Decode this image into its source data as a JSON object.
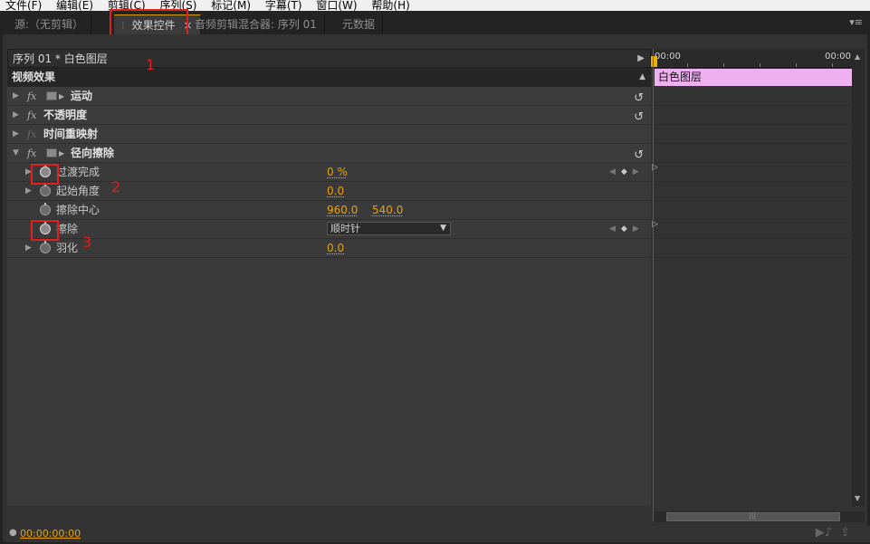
{
  "menu": [
    "文件(F)",
    "编辑(E)",
    "剪辑(C)",
    "序列(S)",
    "标记(M)",
    "字幕(T)",
    "窗口(W)",
    "帮助(H)"
  ],
  "tabs": {
    "source": "源:（无剪辑）",
    "effect_controls": "效果控件",
    "audio_mixer": "音频剪辑混合器: 序列 01",
    "metadata": "元数据",
    "close_glyph": "×"
  },
  "sequence_header": "序列 01 * 白色图层",
  "video_effects_label": "视频效果",
  "effects": [
    {
      "fx": "fx",
      "name": "运动"
    },
    {
      "fx": "fx",
      "name": "不透明度"
    },
    {
      "fx": "fx",
      "name": "时间重映射"
    },
    {
      "fx": "fx",
      "name": "径向擦除"
    }
  ],
  "properties": [
    {
      "name": "过渡完成",
      "value": "0 %"
    },
    {
      "name": "起始角度",
      "value": "0.0"
    },
    {
      "name": "擦除中心",
      "value_x": "960.0",
      "value_y": "540.0"
    },
    {
      "name": "擦除",
      "value": "顺时针"
    },
    {
      "name": "羽化",
      "value": "0.0"
    }
  ],
  "timeline": {
    "start_tc": "00:00",
    "end_tc": "00:00",
    "clip_label": "白色图层"
  },
  "status": {
    "timecode": "00:00:00:00"
  },
  "annotations": {
    "one": "1",
    "two": "2",
    "three": "3"
  },
  "colors": {
    "accent": "#e8a10c",
    "clip": "#efb0ef",
    "annotation": "#e02020",
    "playhead": "#c03030"
  }
}
